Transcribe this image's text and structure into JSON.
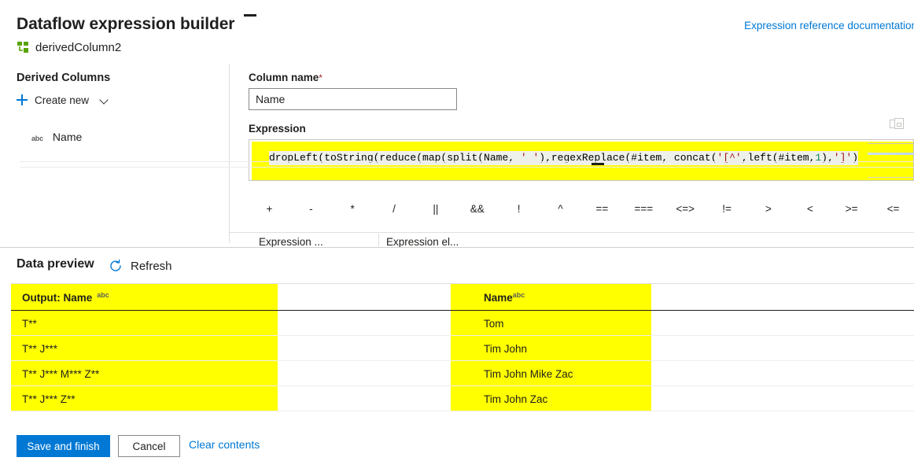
{
  "header": {
    "title": "Dataflow expression builder",
    "doc_link": "Expression reference documentation",
    "stream_name": "derivedColumn2",
    "stream_icon": "derived-column-icon"
  },
  "left_pane": {
    "section_title": "Derived Columns",
    "create_new_label": "Create new",
    "create_new_icon": "plus-icon",
    "create_new_chevron": "chevron-down-icon",
    "columns": [
      {
        "type_tag": "abc",
        "name": "Name"
      }
    ]
  },
  "right_pane": {
    "column_name_label": "Column name",
    "required_marker": "*",
    "column_name_value": "Name",
    "column_name_placeholder": "Column name",
    "expression_label": "Expression",
    "expand_icon": "expand-editor-icon",
    "expression_value": "dropLeft(toString(reduce(map(split(Name, ' '),regexReplace(#item, concat('[^',left(#item,1),']')",
    "expression_tokens": [
      {
        "t": "dropLeft(toString(reduce(map(split(Name, ",
        "k": "plain"
      },
      {
        "t": "' '",
        "k": "str"
      },
      {
        "t": "),regexReplace(#item, concat(",
        "k": "plain"
      },
      {
        "t": "'[^'",
        "k": "str"
      },
      {
        "t": ",left(#item,",
        "k": "plain"
      },
      {
        "t": "1",
        "k": "num"
      },
      {
        "t": "),",
        "k": "plain"
      },
      {
        "t": "']'",
        "k": "str"
      },
      {
        "t": ")",
        "k": "plain"
      }
    ],
    "operators": [
      "+",
      "-",
      "*",
      "/",
      "||",
      "&&",
      "!",
      "^",
      "==",
      "===",
      "<=>",
      "!=",
      ">",
      "<",
      ">=",
      "<="
    ],
    "tabs": [
      {
        "label": "Expression ..."
      },
      {
        "label": "Expression el..."
      }
    ]
  },
  "data_preview": {
    "title": "Data preview",
    "refresh_label": "Refresh",
    "refresh_icon": "refresh-icon",
    "columns": [
      {
        "label": "Output: Name",
        "type_tag": "abc",
        "highlighted": true
      },
      {
        "label": "Name",
        "type_tag": "abc",
        "highlighted": true
      }
    ],
    "rows": [
      {
        "output": "T**",
        "name": "Tom"
      },
      {
        "output": "T** J***",
        "name": "Tim John"
      },
      {
        "output": "T** J*** M*** Z**",
        "name": "Tim John Mike Zac"
      },
      {
        "output": "T** J*** Z**",
        "name": "Tim John Zac"
      }
    ]
  },
  "footer": {
    "save_label": "Save and finish",
    "cancel_label": "Cancel",
    "clear_label": "Clear contents"
  },
  "colors": {
    "accent": "#0078d4",
    "highlight": "#ffff00",
    "required": "#a4262c",
    "text": "#201f1e",
    "icon_green": "#57a300"
  }
}
